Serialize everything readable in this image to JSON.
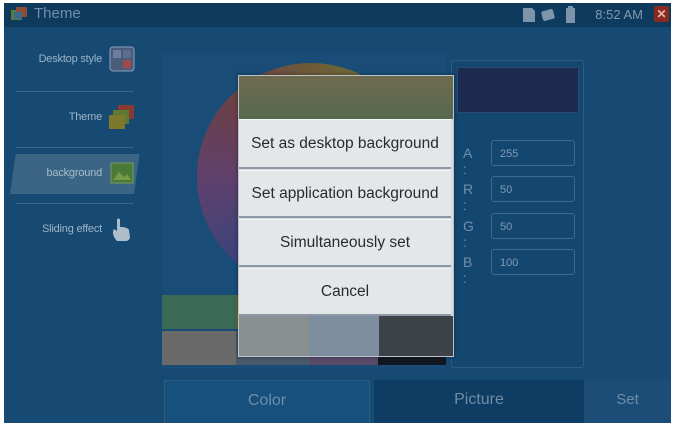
{
  "status_bar": {
    "app_title": "Theme",
    "time": "8:52 AM",
    "icons": [
      "sd-card-icon",
      "phone-icon",
      "battery-icon",
      "close-icon"
    ],
    "close_glyph": "✕"
  },
  "sidebar": {
    "items": [
      {
        "label": "Desktop style",
        "icon": "desktop-style-icon"
      },
      {
        "label": "Theme",
        "icon": "theme-icon"
      },
      {
        "label": "background",
        "icon": "background-icon",
        "selected": true
      },
      {
        "label": "Sliding effect",
        "icon": "hand-gesture-icon"
      }
    ]
  },
  "color_editor": {
    "fields": [
      {
        "key": "A :",
        "value": "255"
      },
      {
        "key": "R :",
        "value": "50"
      },
      {
        "key": "G :",
        "value": "50"
      },
      {
        "key": "B :",
        "value": "100"
      }
    ],
    "preview_color": "#1d2a4f"
  },
  "tabs": {
    "color": "Color",
    "picture": "Picture",
    "set": "Set",
    "active": "Color"
  },
  "dialog": {
    "options": [
      "Set as desktop background",
      "Set application background",
      "Simultaneously set",
      "Cancel"
    ]
  },
  "colors": {
    "screen_bg": "#164a73",
    "statusbar_bg": "#0e3a5e",
    "dialog_bg": "#e4e7ea"
  }
}
